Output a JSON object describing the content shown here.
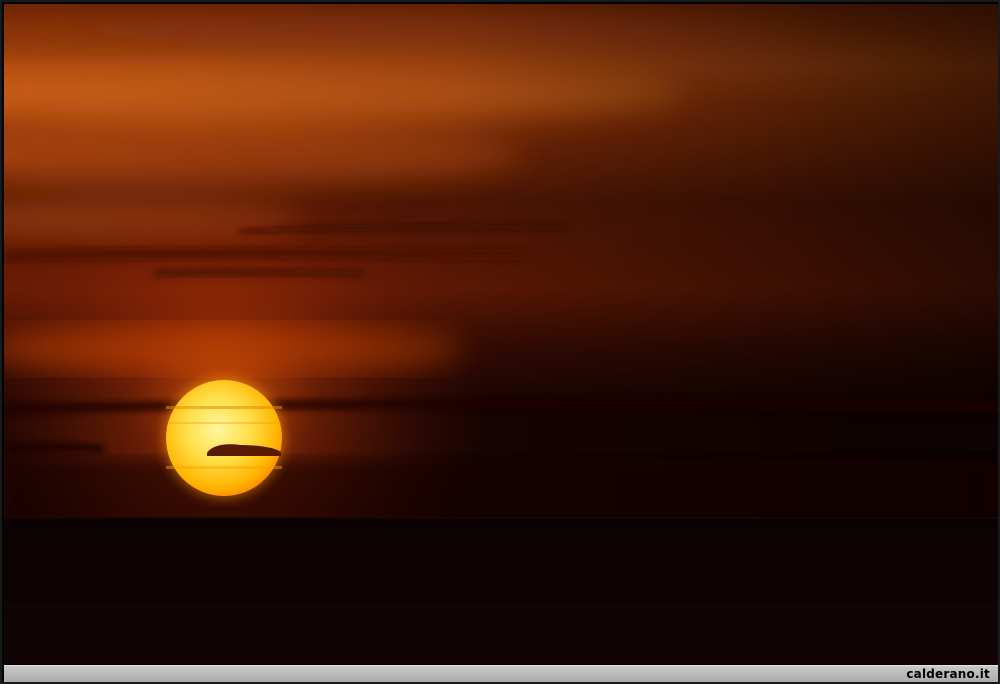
{
  "photo": {
    "subject": "sunset-over-sea",
    "colors": {
      "sky_top": "#7a2a0a",
      "sky_mid": "#a8400d",
      "sky_dark": "#2a0904",
      "sun_core": "#fff27a",
      "sun_edge": "#ffb000",
      "sea": "#0b0303"
    }
  },
  "footer": {
    "watermark": "calderano.it"
  }
}
